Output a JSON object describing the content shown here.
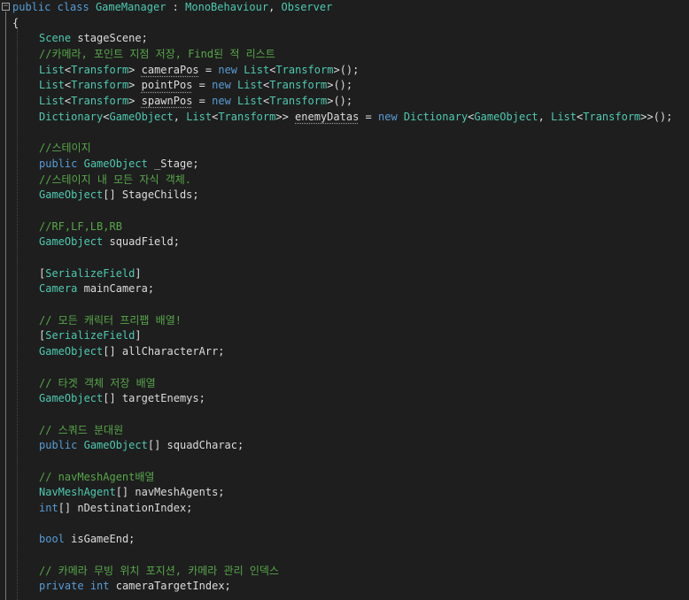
{
  "editor": {
    "header": {
      "kw_public": "public",
      "kw_class": "class",
      "name": "GameManager",
      "colon": ":",
      "base": "MonoBehaviour",
      "comma": ",",
      "iface": "Observer"
    },
    "open_brace": "{",
    "stage_scene": {
      "type": "Scene",
      "rest": "stageScene;"
    },
    "comment_lists": "//카메라, 포인트 지점 저장, Find된 적 리스트",
    "camera_pos": {
      "t1": "List",
      "t2": "Transform",
      "name": "cameraPos",
      "eq": "=",
      "kw_new": "new",
      "t3": "List",
      "t4": "Transform",
      "end": "();"
    },
    "point_pos": {
      "t1": "List",
      "t2": "Transform",
      "name": "pointPos",
      "eq": "=",
      "kw_new": "new",
      "t3": "List",
      "t4": "Transform",
      "end": "();"
    },
    "spawn_pos": {
      "t1": "List",
      "t2": "Transform",
      "name": "spawnPos",
      "eq": "=",
      "kw_new": "new",
      "t3": "List",
      "t4": "Transform",
      "end": "();"
    },
    "enemy_datas": {
      "t1": "Dictionary",
      "t2": "GameObject",
      "t3": "List",
      "t4": "Transform",
      "name": "enemyDatas",
      "eq": "=",
      "kw_new": "new",
      "t5": "Dictionary",
      "t6": "GameObject",
      "t7": "List",
      "t8": "Transform",
      "end": "();"
    },
    "comment_stage": "//스테이지",
    "stage_field": {
      "kw": "public",
      "type": "GameObject",
      "rest": "_Stage;"
    },
    "comment_stage_children": "//스테이지 내 모든 자식 객체.",
    "stage_childs": {
      "type": "GameObject",
      "rest": "[] StageChilds;"
    },
    "comment_rf": "//RF,LF,LB,RB",
    "squad_field": {
      "type": "GameObject",
      "rest": "squadField;"
    },
    "attr_1": {
      "open": "[",
      "name": "SerializeField",
      "close": "]"
    },
    "main_camera": {
      "type": "Camera",
      "rest": "mainCamera;"
    },
    "comment_all_chars": "// 모든 캐릭터 프리팹 배열!",
    "attr_2": {
      "open": "[",
      "name": "SerializeField",
      "close": "]"
    },
    "all_chars": {
      "type": "GameObject",
      "rest": "[] allCharacterArr;"
    },
    "comment_targets": "// 타겟 객체 저장 배열",
    "target_enemys": {
      "type": "GameObject",
      "rest": "[] targetEnemys;"
    },
    "comment_squad": "// 스쿼드 분대원",
    "squad_charac": {
      "kw": "public",
      "type": "GameObject",
      "rest": "[] squadCharac;"
    },
    "comment_nav": "// navMeshAgent배열",
    "nav_agents": {
      "type": "NavMeshAgent",
      "rest": "[] navMeshAgents;"
    },
    "dest_index": {
      "kw": "int",
      "rest": "[] nDestinationIndex;"
    },
    "game_end": {
      "kw": "bool",
      "rest": "isGameEnd;"
    },
    "comment_camera": "// 카메라 무빙 위치 포지션, 카메라 관리 인덱스",
    "camera_target": {
      "kw": "private",
      "kw2": "int",
      "rest": "cameraTargetIndex;"
    }
  }
}
